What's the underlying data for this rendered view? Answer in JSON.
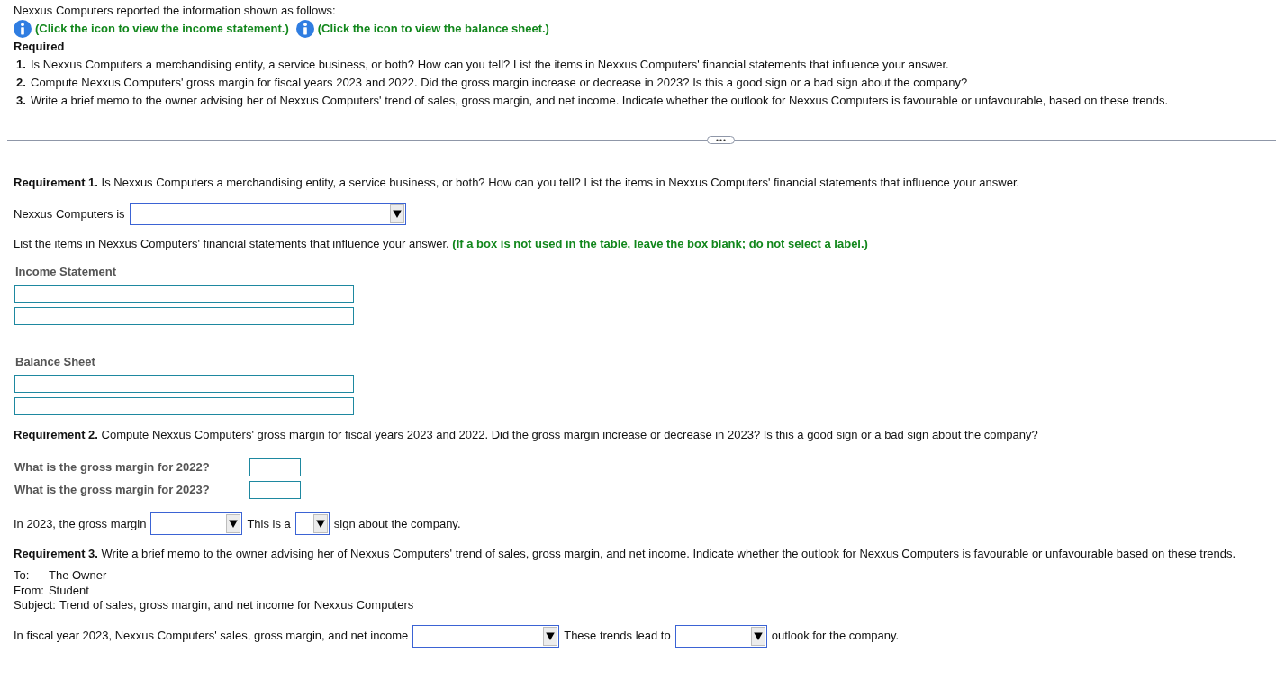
{
  "intro": "Nexxus Computers reported the information shown as follows:",
  "info_links": [
    {
      "text": "(Click the icon to view the income statement.)"
    },
    {
      "text": "(Click the icon to view the balance sheet.)"
    }
  ],
  "required": {
    "heading": "Required",
    "items": [
      {
        "number": "1.",
        "text": "Is Nexxus Computers a merchandising entity, a service business, or both? How can you tell? List the items in Nexxus Computers' financial statements that influence your answer."
      },
      {
        "number": "2.",
        "text": "Compute Nexxus Computers' gross margin for fiscal years 2023 and 2022. Did the gross margin increase or decrease in 2023? Is this a good sign or a bad sign about the company?"
      },
      {
        "number": "3.",
        "text": "Write a brief memo to the owner advising her of Nexxus Computers' trend of sales, gross margin, and net income. Indicate whether the outlook for Nexxus Computers is favourable or unfavourable, based on these trends."
      }
    ]
  },
  "requirement_1": {
    "prompt": "**Requirement 1.** Is Nexxus Computers a merchandising entity, a service business, or both? How can you tell? List the items in Nexxus Computers' financial statements that influence your answer.",
    "answer_line": [
      {
        "kind": "text",
        "text": "Nexxus Computers is"
      },
      {
        "kind": "dropdown"
      }
    ],
    "list_prompt": "List the items in Nexxus Computers' financial statements that influence your answer. **(If a box is not used in the table, leave the box blank; do not select a label.)**",
    "statements": [
      {
        "heading": "Income Statement",
        "fields": [
          {
            "kind": "input"
          },
          {
            "kind": "input"
          }
        ]
      },
      {
        "heading": "Balance Sheet",
        "fields": [
          {
            "kind": "input"
          },
          {
            "kind": "input"
          }
        ]
      }
    ]
  },
  "requirement_2": {
    "prompt": "**Requirement 2.** Compute Nexxus Computers' gross margin for fiscal years 2023 and 2022. Did the gross margin increase or decrease in 2023? Is this a good sign or a bad sign about the company?",
    "questions": [
      {
        "label": "What is the gross margin for 2022?",
        "kind": "input"
      },
      {
        "label": "What is the gross margin for 2023?",
        "kind": "input"
      }
    ],
    "answer_line": [
      {
        "kind": "text",
        "text": "In 2023, the gross margin"
      },
      {
        "kind": "dropdown"
      },
      {
        "kind": "text",
        "text": "This is a"
      },
      {
        "kind": "dropdown"
      },
      {
        "kind": "text",
        "text": "sign about the company."
      }
    ]
  },
  "requirement_3": {
    "prompt": "**Requirement 3.** Write a brief memo to the owner advising her of Nexxus Computers' trend of sales, gross margin, and net income. Indicate whether the outlook for Nexxus Computers is favourable or unfavourable based on these trends.",
    "memo": {
      "to": {
        "label": "To:",
        "value": "The Owner"
      },
      "from": {
        "label": "From:",
        "value": "Student"
      },
      "subject": {
        "label": "Subject:",
        "value": "Trend of sales, gross margin, and net income for Nexxus Computers"
      }
    },
    "answer_line": [
      {
        "kind": "text",
        "text": "In fiscal year 2023, Nexxus Computers' sales, gross margin, and net income"
      },
      {
        "kind": "dropdown"
      },
      {
        "kind": "text",
        "text": "These trends lead to"
      },
      {
        "kind": "dropdown"
      },
      {
        "kind": "text",
        "text": "outlook for the company."
      }
    ]
  }
}
